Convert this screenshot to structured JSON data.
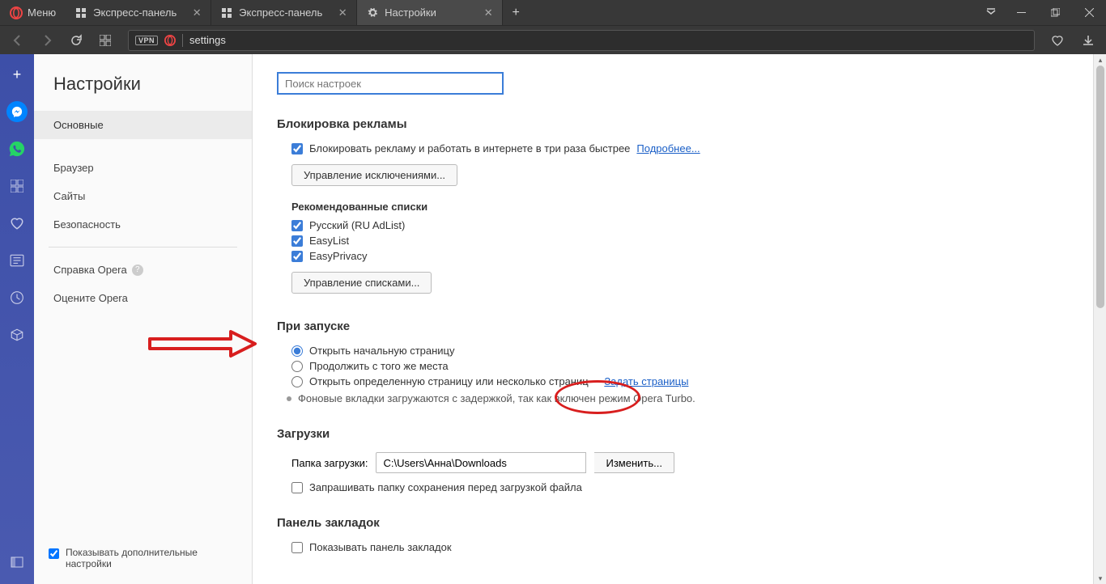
{
  "titlebar": {
    "menu_label": "Меню",
    "tabs": [
      {
        "label": "Экспресс-панель"
      },
      {
        "label": "Экспресс-панель"
      },
      {
        "label": "Настройки"
      }
    ]
  },
  "addressbar": {
    "vpn_label": "VPN",
    "url_text": "settings"
  },
  "sidebar": {
    "title": "Настройки",
    "items": [
      "Основные",
      "Браузер",
      "Сайты",
      "Безопасность"
    ],
    "help_label": "Справка Opera",
    "rate_label": "Оцените Opera",
    "show_advanced": "Показывать дополнительные настройки"
  },
  "content": {
    "search_placeholder": "Поиск настроек",
    "adblock": {
      "heading": "Блокировка рекламы",
      "block_label": "Блокировать рекламу и работать в интернете в три раза быстрее",
      "more_link": "Подробнее...",
      "exceptions_btn": "Управление исключениями...",
      "lists_heading": "Рекомендованные списки",
      "lists": [
        "Русский (RU AdList)",
        "EasyList",
        "EasyPrivacy"
      ],
      "manage_lists_btn": "Управление списками..."
    },
    "startup": {
      "heading": "При запуске",
      "opt1": "Открыть начальную страницу",
      "opt2": "Продолжить с того же места",
      "opt3": "Открыть определенную страницу или несколько страниц",
      "set_pages_link": "Задать страницы",
      "turbo_note": "Фоновые вкладки загружаются с задержкой, так как включен режим Opera Turbo."
    },
    "downloads": {
      "heading": "Загрузки",
      "folder_label": "Папка загрузки:",
      "folder_value": "C:\\Users\\Анна\\Downloads",
      "change_btn": "Изменить...",
      "ask_label": "Запрашивать папку сохранения перед загрузкой файла"
    },
    "bookmarks": {
      "heading": "Панель закладок",
      "show_label": "Показывать панель закладок"
    }
  }
}
